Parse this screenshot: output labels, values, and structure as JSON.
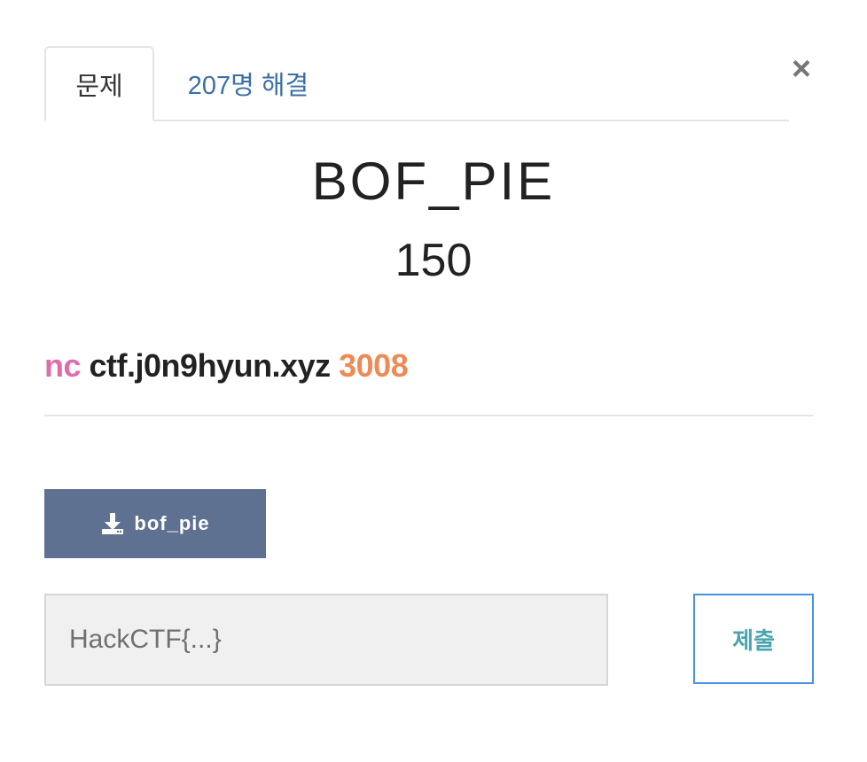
{
  "tabs": {
    "problem": "문제",
    "solves": "207명 해결"
  },
  "close_label": "×",
  "challenge": {
    "title": "BOF_PIE",
    "points": "150",
    "desc_nc": "nc",
    "desc_host": "ctf.j0n9hyun.xyz",
    "desc_port": "3008"
  },
  "download": {
    "label": "bof_pie",
    "icon": "download-icon"
  },
  "flag": {
    "placeholder": "HackCTF{...}",
    "value": ""
  },
  "submit_label": "제출",
  "colors": {
    "nc": "#e26bab",
    "port": "#ee8a55",
    "download_bg": "#5e7190",
    "tab_link": "#3a6fa8",
    "submit_text": "#4aa5b0",
    "submit_border": "#4a90e2"
  }
}
